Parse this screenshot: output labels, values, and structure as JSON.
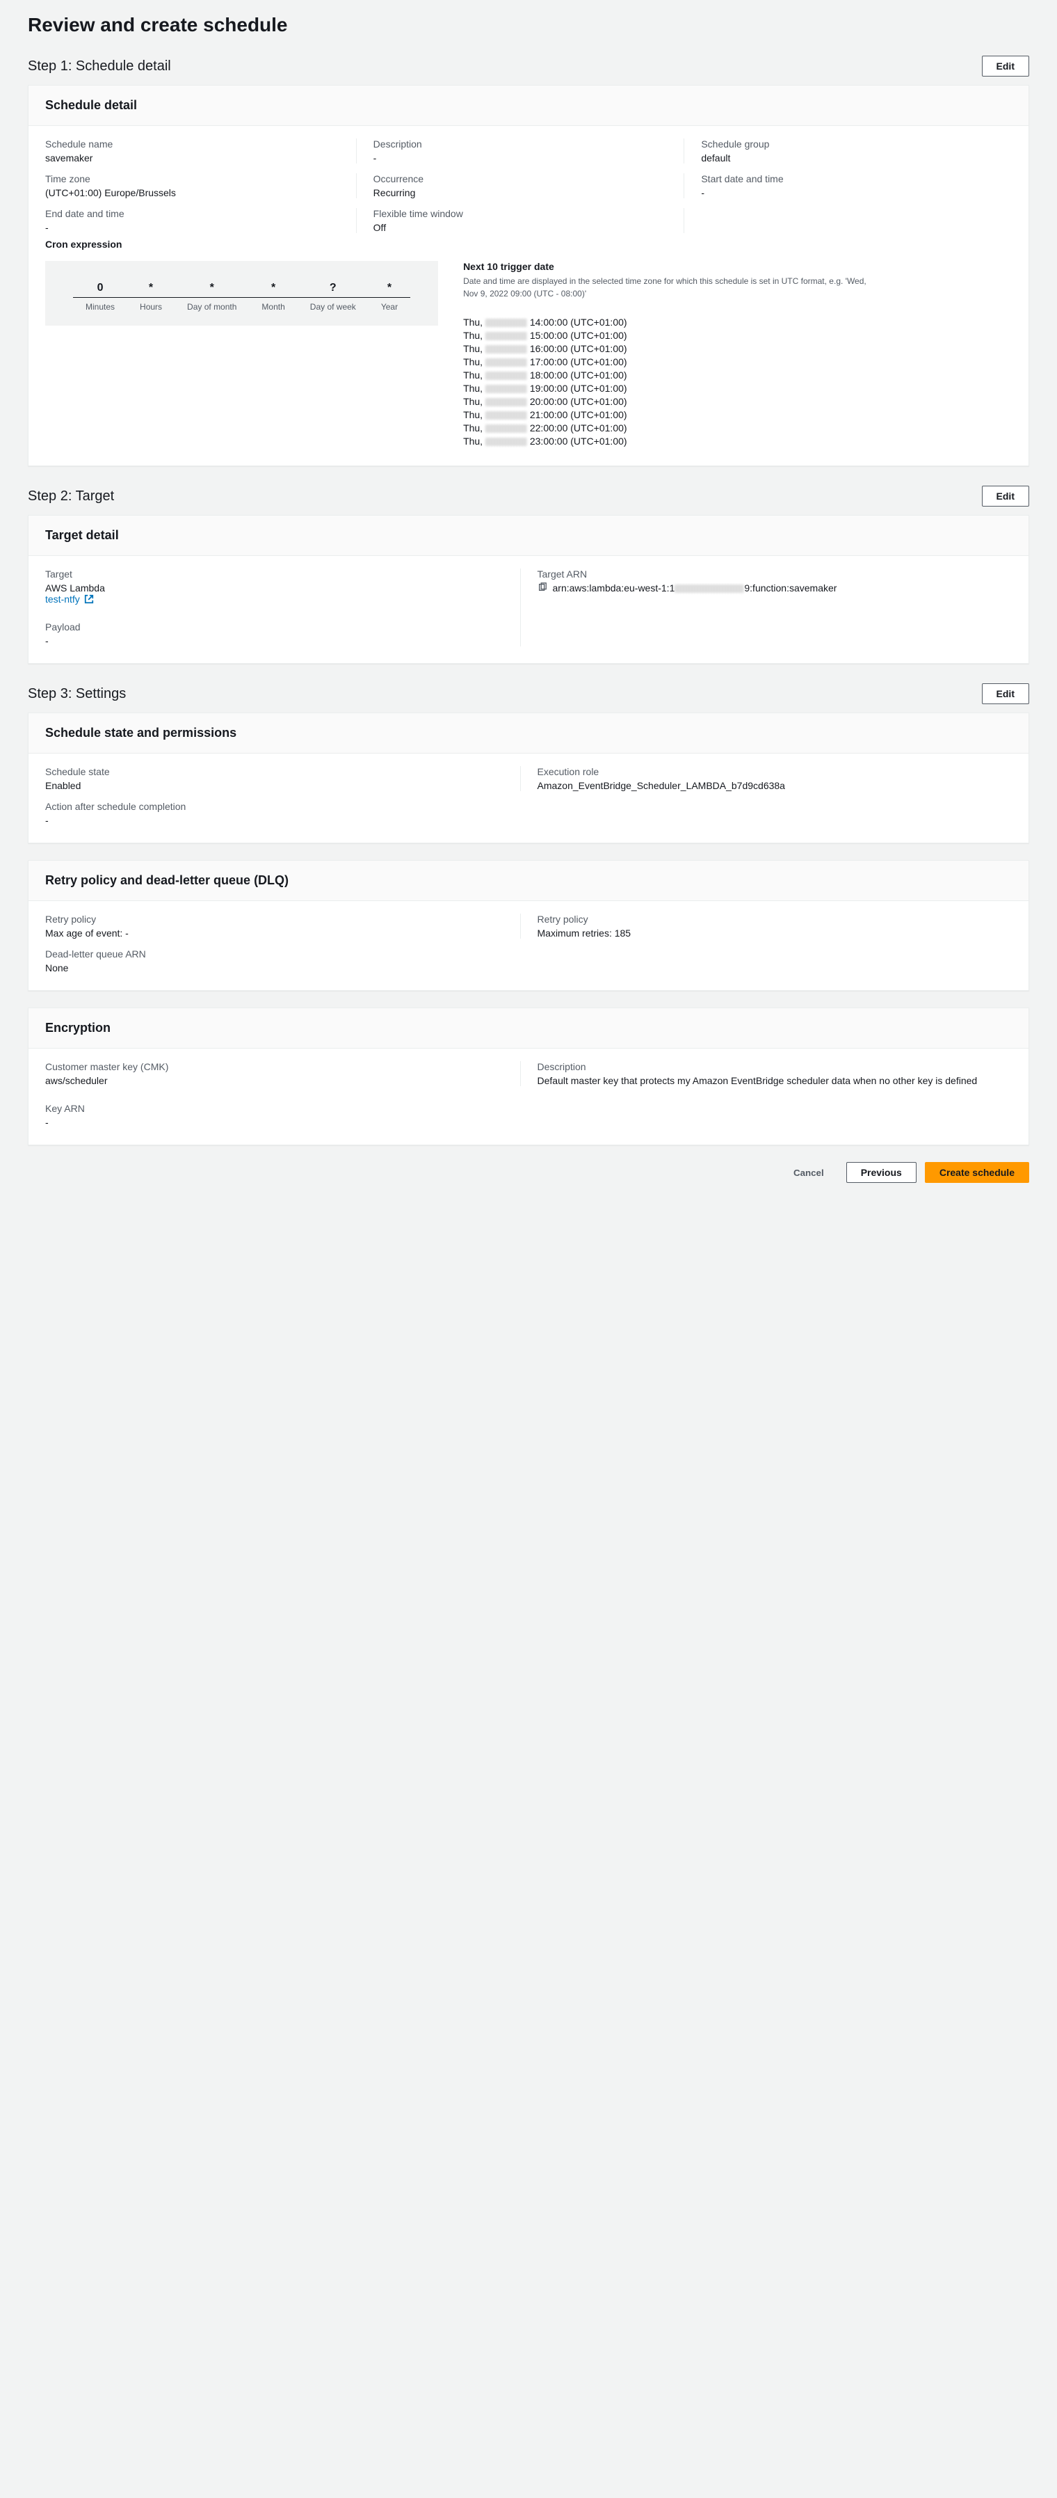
{
  "page_title": "Review and create schedule",
  "edit_label": "Edit",
  "steps": {
    "s1": {
      "title": "Step 1: Schedule detail"
    },
    "s2": {
      "title": "Step 2: Target"
    },
    "s3": {
      "title": "Step 3: Settings"
    }
  },
  "schedule_detail": {
    "panel_title": "Schedule detail",
    "name_label": "Schedule name",
    "name_value": "savemaker",
    "desc_label": "Description",
    "desc_value": "-",
    "group_label": "Schedule group",
    "group_value": "default",
    "tz_label": "Time zone",
    "tz_value": "(UTC+01:00) Europe/Brussels",
    "occ_label": "Occurrence",
    "occ_value": "Recurring",
    "start_label": "Start date and time",
    "start_value": "-",
    "end_label": "End date and time",
    "end_value": "-",
    "flex_label": "Flexible time window",
    "flex_value": "Off",
    "cron_label": "Cron expression",
    "cron": {
      "minutes": "0",
      "hours": "*",
      "dom": "*",
      "month": "*",
      "dow": "?",
      "year": "*",
      "lbl_minutes": "Minutes",
      "lbl_hours": "Hours",
      "lbl_dom": "Day of month",
      "lbl_month": "Month",
      "lbl_dow": "Day of week",
      "lbl_year": "Year"
    },
    "next10_title": "Next 10 trigger date",
    "next10_desc": "Date and time are displayed in the selected time zone for which this schedule is set in UTC format, e.g. 'Wed, Nov 9, 2022 09:00 (UTC - 08:00)'",
    "triggers": [
      {
        "prefix": "Thu, ",
        "suffix": " 14:00:00 (UTC+01:00)"
      },
      {
        "prefix": "Thu, ",
        "suffix": " 15:00:00 (UTC+01:00)"
      },
      {
        "prefix": "Thu, ",
        "suffix": " 16:00:00 (UTC+01:00)"
      },
      {
        "prefix": "Thu, ",
        "suffix": " 17:00:00 (UTC+01:00)"
      },
      {
        "prefix": "Thu, ",
        "suffix": " 18:00:00 (UTC+01:00)"
      },
      {
        "prefix": "Thu, ",
        "suffix": " 19:00:00 (UTC+01:00)"
      },
      {
        "prefix": "Thu, ",
        "suffix": " 20:00:00 (UTC+01:00)"
      },
      {
        "prefix": "Thu, ",
        "suffix": " 21:00:00 (UTC+01:00)"
      },
      {
        "prefix": "Thu, ",
        "suffix": " 22:00:00 (UTC+01:00)"
      },
      {
        "prefix": "Thu, ",
        "suffix": " 23:00:00 (UTC+01:00)"
      }
    ]
  },
  "target": {
    "panel_title": "Target detail",
    "target_label": "Target",
    "target_value": "AWS Lambda",
    "link_text": "test-ntfy",
    "payload_label": "Payload",
    "payload_value": "-",
    "arn_label": "Target ARN",
    "arn_line1": "arn:aws:lambda:eu-west-1:1",
    "arn_line2": "9:function:savemaker"
  },
  "state_perms": {
    "panel_title": "Schedule state and permissions",
    "state_label": "Schedule state",
    "state_value": "Enabled",
    "role_label": "Execution role",
    "role_value": "Amazon_EventBridge_Scheduler_LAMBDA_b7d9cd638a",
    "action_label": "Action after schedule completion",
    "action_value": "-"
  },
  "retry": {
    "panel_title": "Retry policy and dead-letter queue (DLQ)",
    "p1_label": "Retry policy",
    "p1_value": "Max age of event: -",
    "p2_label": "Retry policy",
    "p2_value": "Maximum retries: 185",
    "dlq_label": "Dead-letter queue ARN",
    "dlq_value": "None"
  },
  "encryption": {
    "panel_title": "Encryption",
    "cmk_label": "Customer master key (CMK)",
    "cmk_value": "aws/scheduler",
    "desc_label": "Description",
    "desc_value": "Default master key that protects my Amazon EventBridge scheduler data when no other key is defined",
    "arn_label": "Key ARN",
    "arn_value": "-"
  },
  "footer": {
    "cancel": "Cancel",
    "previous": "Previous",
    "create": "Create schedule"
  }
}
